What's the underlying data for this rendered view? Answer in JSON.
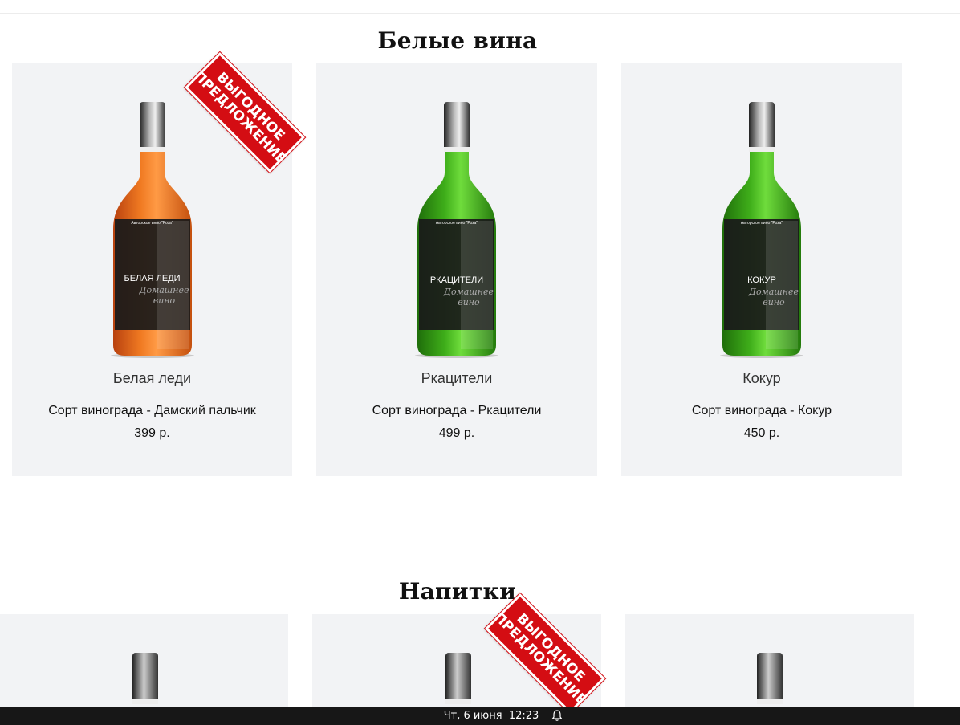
{
  "sections": [
    {
      "title": "Белые вина",
      "products": [
        {
          "name": "Белая леди",
          "grape": "Сорт винограда - Дамский пальчик",
          "price": "399 р.",
          "label_title": "БЕЛАЯ ЛЕДИ",
          "label_top": "Авторское вино \"Роза\"",
          "label_script": "Домашнее вино",
          "bottle_color": "#f07a22",
          "badge": "ВЫГОДНОЕ ПРЕДЛОЖЕНИЕ"
        },
        {
          "name": "Ркацители",
          "grape": "Сорт винограда - Ркацители",
          "price": "499 р.",
          "label_title": "РКАЦИТЕЛИ",
          "label_top": "Авторское вино \"Роза\"",
          "label_script": "Домашнее вино",
          "bottle_color": "#3fae1a"
        },
        {
          "name": "Кокур",
          "grape": "Сорт винограда - Кокур",
          "price": "450 р.",
          "label_title": "КОКУР",
          "label_top": "Авторское вино \"Роза\"",
          "label_script": "Домашнее вино",
          "bottle_color": "#3fae1a"
        }
      ]
    },
    {
      "title": "Напитки",
      "badge": "ВЫГОДНОЕ ПРЕДЛОЖЕНИЕ"
    }
  ],
  "badge_lines": [
    "ВЫГОДНОЕ",
    "ПРЕДЛОЖЕНИЕ"
  ],
  "taskbar": {
    "clock": "Чт, 6 июня  12:23",
    "bell_icon": "bell-icon"
  },
  "colors": {
    "card_bg": "#f2f3f5",
    "badge_red": "#d40d13",
    "taskbar": "#171717"
  }
}
